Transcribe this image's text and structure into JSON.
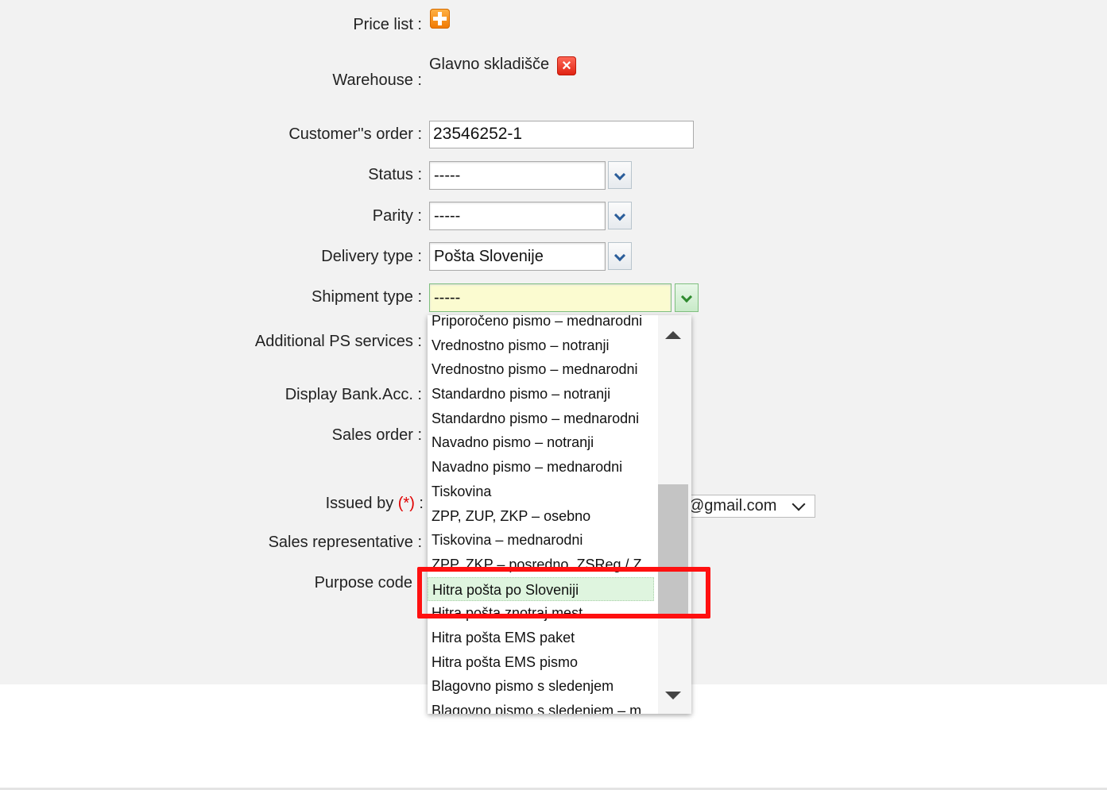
{
  "form": {
    "price_list_label": "Price list :",
    "warehouse_label": "Warehouse :",
    "warehouse_value": "Glavno skladišče",
    "customer_order_label": "Customer''s order :",
    "customer_order_value": "23546252-1",
    "status_label": "Status :",
    "status_value": "-----",
    "parity_label": "Parity :",
    "parity_value": "-----",
    "delivery_type_label": "Delivery type :",
    "delivery_type_value": "Pošta Slovenije",
    "shipment_type_label": "Shipment type :",
    "shipment_type_value": "-----",
    "additional_ps_label": "Additional PS services :",
    "display_bank_label": "Display Bank.Acc. :",
    "sales_order_label": "Sales order :",
    "issued_by_label": "Issued by",
    "required_marker": "(*)",
    "issued_by_colon": " :",
    "issued_by_value": "@gmail.com",
    "sales_rep_label": "Sales representative :",
    "purpose_code_label": "Purpose code"
  },
  "icons": {
    "add": "plus-icon",
    "remove": "remove-icon",
    "dropdown": "chevron-down-icon"
  },
  "dropdown": {
    "items": [
      "Priporočeno pismo – mednarodni",
      "Vrednostno pismo – notranji",
      "Vrednostno pismo – mednarodni",
      "Standardno pismo – notranji",
      "Standardno pismo – mednarodni",
      "Navadno pismo – notranji",
      "Navadno pismo – mednarodni",
      "Tiskovina",
      "ZPP, ZUP, ZKP – osebno",
      "Tiskovina – mednarodni",
      "ZPP, ZKP – posredno, ZSReg / Z",
      "Hitra pošta po Sloveniji",
      "Hitra pošta znotraj mest",
      "Hitra pošta EMS paket",
      "Hitra pošta EMS pismo",
      "Blagovno pismo s sledenjem",
      "Blagovno pismo s sledenjem – m"
    ],
    "selected_index": 11
  },
  "colors": {
    "panel_bg": "#f2f2f2",
    "highlight": "#ff1010",
    "active_field": "#fbfbd0",
    "selected_item": "#dff5df"
  }
}
